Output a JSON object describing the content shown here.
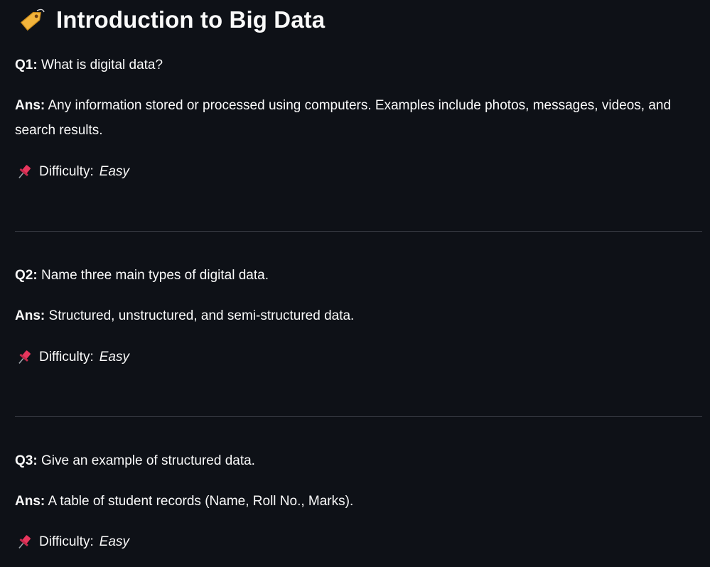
{
  "header": {
    "title": "Introduction to Big Data",
    "icon": "label-tag-icon"
  },
  "questions": [
    {
      "q_label": "Q1:",
      "question": "What is digital data?",
      "a_label": "Ans:",
      "answer": "Any information stored or processed using computers. Examples include photos, messages, videos, and search results.",
      "difficulty_label": "Difficulty:",
      "difficulty": "Easy"
    },
    {
      "q_label": "Q2:",
      "question": "Name three main types of digital data.",
      "a_label": "Ans:",
      "answer": "Structured, unstructured, and semi-structured data.",
      "difficulty_label": "Difficulty:",
      "difficulty": "Easy"
    },
    {
      "q_label": "Q3:",
      "question": "Give an example of structured data.",
      "a_label": "Ans:",
      "answer": "A table of student records (Name, Roll No., Marks).",
      "difficulty_label": "Difficulty:",
      "difficulty": "Easy"
    }
  ],
  "colors": {
    "background": "#0e1117",
    "text": "#fafafa",
    "divider": "#3a3d45",
    "pin": "#e8365d",
    "tag": "#f2b43c"
  }
}
